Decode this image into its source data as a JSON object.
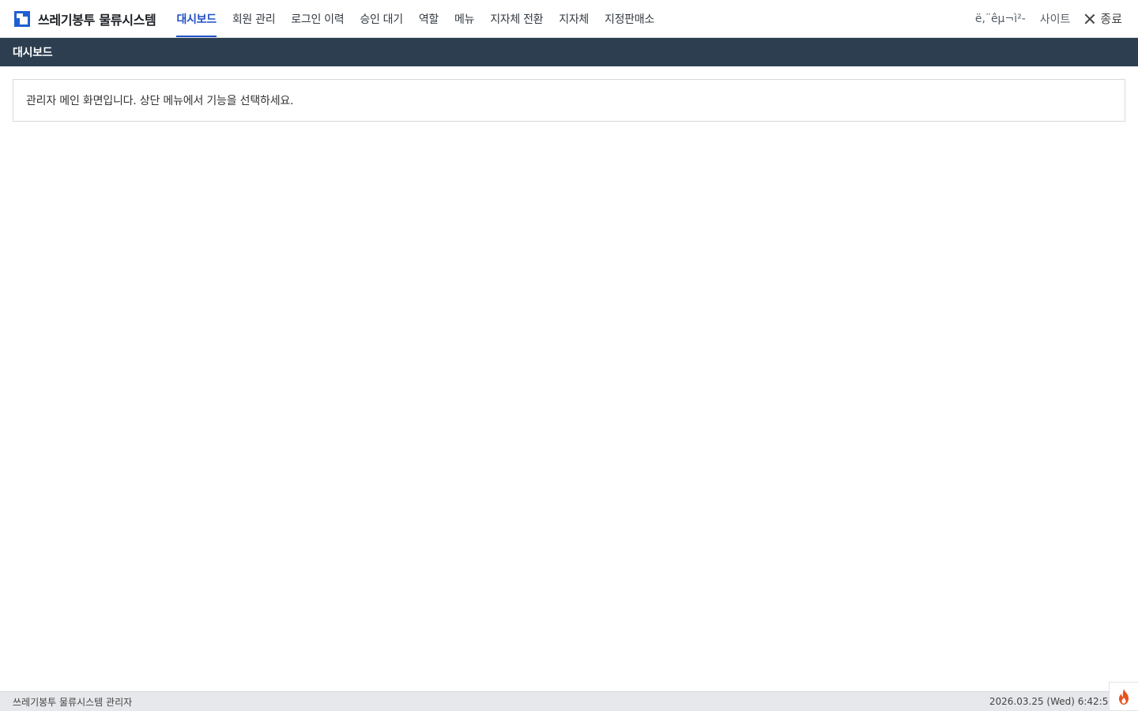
{
  "app": {
    "title": "쓰레기봉투 물류시스템"
  },
  "nav": {
    "items": [
      {
        "label": "대시보드",
        "active": true
      },
      {
        "label": "회원 관리"
      },
      {
        "label": "로그인 이력"
      },
      {
        "label": "승인 대기"
      },
      {
        "label": "역할"
      },
      {
        "label": "메뉴"
      },
      {
        "label": "지자체 전환"
      },
      {
        "label": "지자체"
      },
      {
        "label": "지정판매소"
      }
    ]
  },
  "top_right": {
    "garbled_link": "ë,¨êµ¬ì²-",
    "site_label": "사이트",
    "exit_label": "종료"
  },
  "subheader": {
    "title": "대시보드"
  },
  "main": {
    "message": "관리자 메인 화면입니다. 상단 메뉴에서 기능을 선택하세요."
  },
  "footer": {
    "left": "쓰레기봉투 물류시스템 관리자",
    "datetime": "2026.03.25 (Wed) 6:42:59"
  },
  "colors": {
    "accent": "#1f4fc4",
    "subheader_bg": "#2d3e50",
    "fire_icon": "#e8511f"
  },
  "icons": {
    "logo": "app-logo-icon",
    "close": "close-icon",
    "fire": "fire-icon"
  }
}
